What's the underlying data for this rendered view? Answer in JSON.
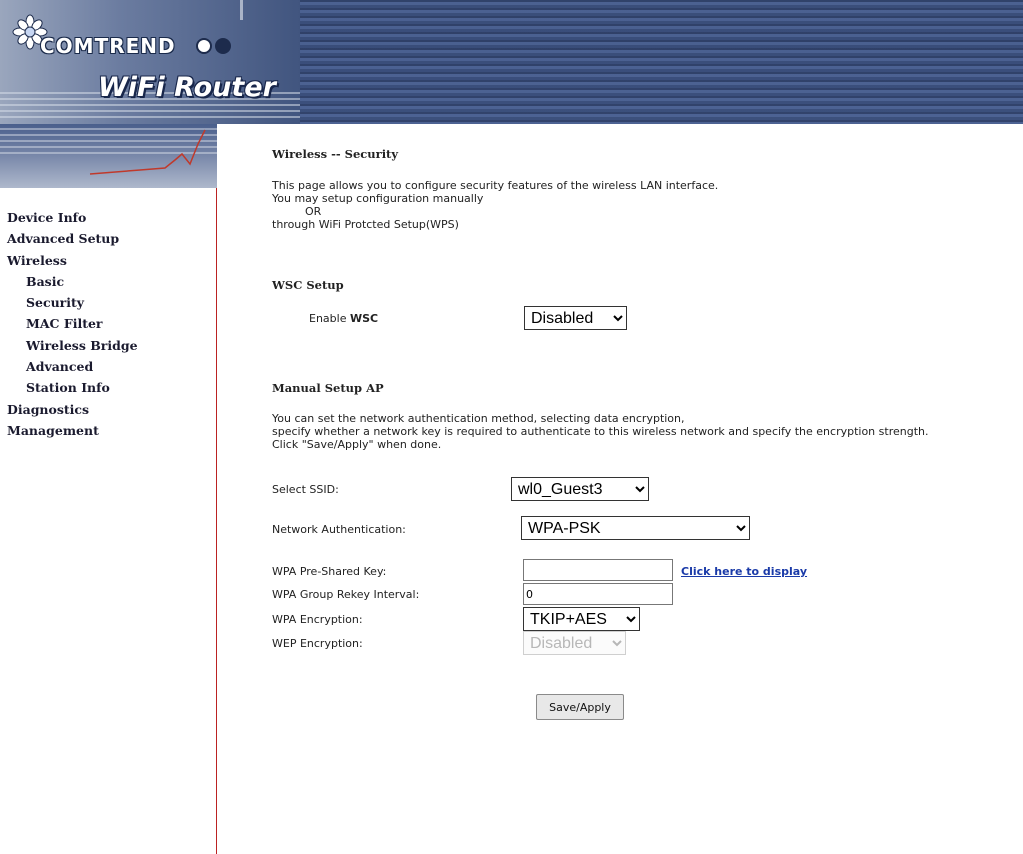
{
  "header": {
    "brand": "COMTREND",
    "product": "WiFi Router",
    "colors": {
      "header_bg": "#3b4f7a",
      "accent_red": "#b22222"
    }
  },
  "sidebar": {
    "items": [
      {
        "label": "Device Info",
        "level": 0
      },
      {
        "label": "Advanced Setup",
        "level": 0
      },
      {
        "label": "Wireless",
        "level": 0
      },
      {
        "label": "Basic",
        "level": 1
      },
      {
        "label": "Security",
        "level": 1
      },
      {
        "label": "MAC Filter",
        "level": 1
      },
      {
        "label": "Wireless Bridge",
        "level": 1
      },
      {
        "label": "Advanced",
        "level": 1
      },
      {
        "label": "Station Info",
        "level": 1
      },
      {
        "label": "Diagnostics",
        "level": 0
      },
      {
        "label": "Management",
        "level": 0
      }
    ]
  },
  "main": {
    "title": "Wireless -- Security",
    "intro": {
      "line1": "This page allows you to configure security features of the wireless LAN interface.",
      "line2": "You may setup configuration manually",
      "line3": "OR",
      "line4": "through WiFi Protcted Setup(WPS)"
    },
    "wsc": {
      "heading": "WSC Setup",
      "enable_label_prefix": "Enable ",
      "enable_label_strong": "WSC",
      "enable_value": "Disabled"
    },
    "manual": {
      "heading": "Manual Setup AP",
      "desc1": "You can set the network authentication method, selecting data encryption,",
      "desc2": "specify whether a network key is required to authenticate to this wireless network and specify the encryption strength.",
      "desc3": "Click \"Save/Apply\" when done.",
      "ssid_label": "Select SSID:",
      "ssid_value": "wl0_Guest3",
      "auth_label": "Network Authentication:",
      "auth_value": "WPA-PSK",
      "psk_label": "WPA Pre-Shared Key:",
      "psk_value": "",
      "psk_link": "Click here to display",
      "rekey_label": "WPA Group Rekey Interval:",
      "rekey_value": "0",
      "wpa_enc_label": "WPA Encryption:",
      "wpa_enc_value": "TKIP+AES",
      "wep_enc_label": "WEP Encryption:",
      "wep_enc_value": "Disabled"
    },
    "save_label": "Save/Apply"
  }
}
